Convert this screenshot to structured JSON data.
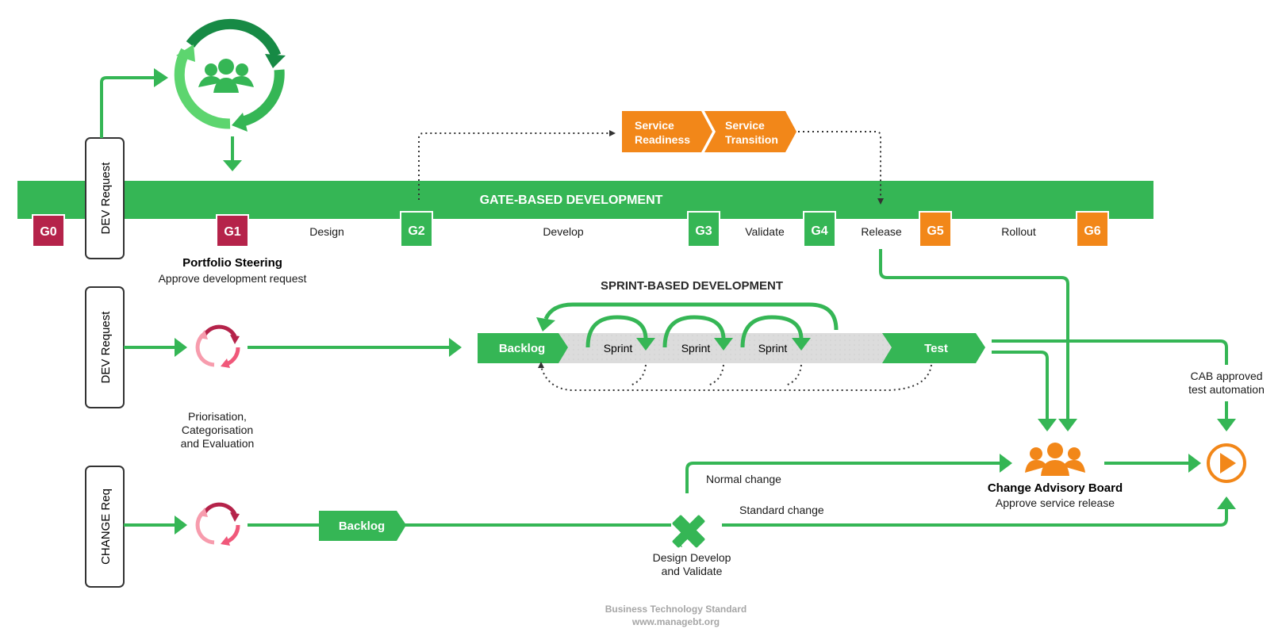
{
  "colors": {
    "green": "#35b655",
    "dark_green": "#178a45",
    "light_green": "#5dd56f",
    "crimson": "#b5234a",
    "orange": "#f28719",
    "pink": "#f79cad",
    "rose": "#f0587a",
    "grey_band": "#dcdcdc",
    "dark": "#2a2a2a",
    "footer": "#a6a6a6"
  },
  "lanes": {
    "gate_lane_label": "DEV Request",
    "sprint_lane_label": "DEV Request",
    "change_lane_label": "CHANGE Req"
  },
  "gate_based": {
    "title": "GATE-BASED DEVELOPMENT",
    "gates": [
      {
        "id": "G0",
        "color": "crimson"
      },
      {
        "id": "G1",
        "color": "crimson"
      },
      {
        "id": "G2",
        "color": "green"
      },
      {
        "id": "G3",
        "color": "green"
      },
      {
        "id": "G4",
        "color": "green"
      },
      {
        "id": "G5",
        "color": "orange"
      },
      {
        "id": "G6",
        "color": "orange"
      }
    ],
    "phases": [
      "Design",
      "Develop",
      "Validate",
      "Release",
      "Rollout"
    ],
    "portfolio_title": "Portfolio Steering",
    "portfolio_subtitle": "Approve development request",
    "service_steps": [
      {
        "line1": "Service",
        "line2": "Readiness"
      },
      {
        "line1": "Service",
        "line2": "Transition"
      }
    ]
  },
  "sprint_based": {
    "title": "SPRINT-BASED DEVELOPMENT",
    "backlog": "Backlog",
    "sprints": [
      "Sprint",
      "Sprint",
      "Sprint"
    ],
    "test": "Test",
    "triage_label": [
      "Priorisation,",
      "Categorisation",
      "and Evaluation"
    ]
  },
  "change": {
    "backlog": "Backlog",
    "design_label": [
      "Design Develop",
      "and Validate"
    ],
    "normal_change": "Normal change",
    "standard_change": "Standard change"
  },
  "cab": {
    "title": "Change Advisory Board",
    "subtitle": "Approve service release",
    "auto_label": [
      "CAB approved",
      "test automation"
    ]
  },
  "icons": {
    "team_cycle": "people-cycle-icon",
    "triage": "refresh-cycle-icon",
    "design": "ruler-pencil-icon",
    "cab": "people-group-icon",
    "deploy": "play-circle-icon"
  },
  "footer": {
    "line1": "Business Technology Standard",
    "line2": "www.managebt.org"
  }
}
